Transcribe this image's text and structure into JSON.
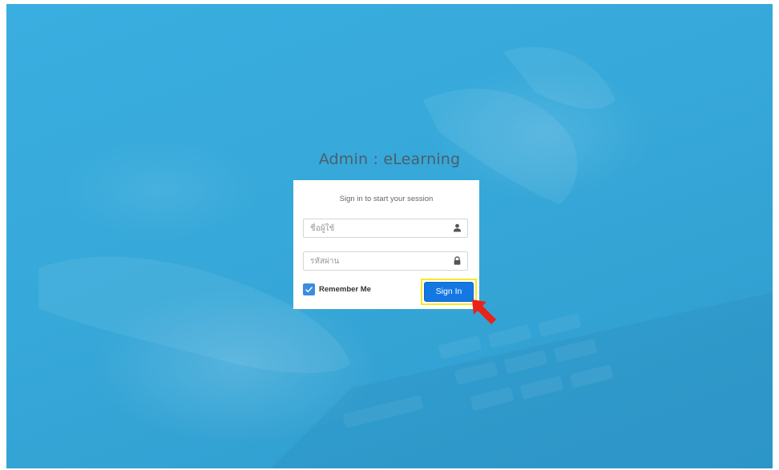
{
  "app": {
    "title": "Admin : eLearning"
  },
  "login": {
    "message": "Sign in to start your session",
    "username_placeholder": "ชื่อผู้ใช้",
    "password_placeholder": "รหัสผ่าน",
    "remember_label": "Remember Me",
    "remember_checked": true,
    "signin_label": "Sign In"
  },
  "icons": {
    "username": "user-icon",
    "password": "lock-icon",
    "checkbox": "check-icon",
    "annotation": "red-arrow-pointer"
  },
  "colors": {
    "background": "#36a8d9",
    "title": "#4a5f6c",
    "button": "#1478e3",
    "checkbox": "#3c8dde",
    "highlight": "#f7ea1f",
    "arrow": "#e8231a"
  }
}
